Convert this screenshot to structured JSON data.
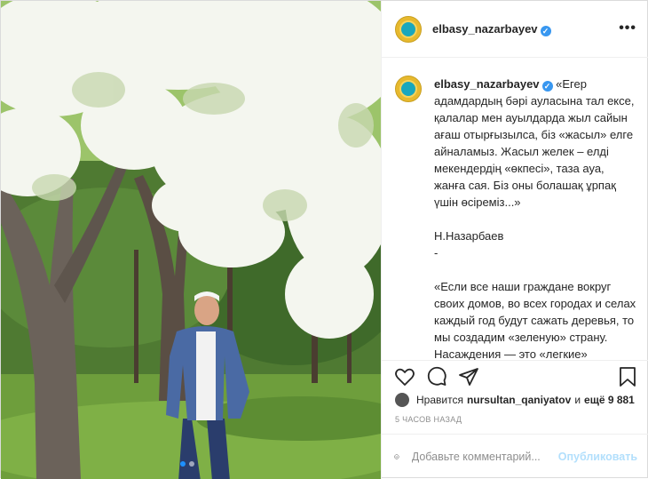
{
  "post": {
    "username": "elbasy_nazarbayev",
    "verified_mark": "✓",
    "more_label": "•••",
    "caption_kk": "«Егер адамдардың бәрі ауласына тал ексе, қалалар мен ауылдарда жыл сайын ағаш отырғызылса, біз «жасыл» елге айналамыз. Жасыл желек – елді мекендердің «өкпесі», таза ауа, жанға сая. Біз оны болашақ ұрпақ үшін өсіреміз...»",
    "signature": "Н.Назарбаев",
    "separator": "-",
    "caption_ru": "«Если все наши граждане вокруг своих домов, во всех городах и селах каждый год будут сажать деревья, то мы создадим «зеленую» страну. Насаждения — это «легкие» населенных пунктов, чистый воздух, защита от непогоды. Мы создаем их для будущих поколений...»"
  },
  "likes": {
    "prefix": "Нравится",
    "user": "nursultan_qaniyatov",
    "and": "и",
    "others": "ещё 9 881"
  },
  "timestamp": "5 ЧАСОВ НАЗАД",
  "comment": {
    "placeholder": "Добавьте комментарий...",
    "publish_label": "Опубликовать"
  },
  "carousel": {
    "count": 2,
    "active": 1
  },
  "icons": [
    "heart-icon",
    "comment-icon",
    "share-icon",
    "bookmark-icon",
    "emoji-icon",
    "more-icon"
  ],
  "colors": {
    "verified": "#3897f0",
    "publish_disabled": "#b2dffc",
    "muted": "#8e8e8e"
  }
}
